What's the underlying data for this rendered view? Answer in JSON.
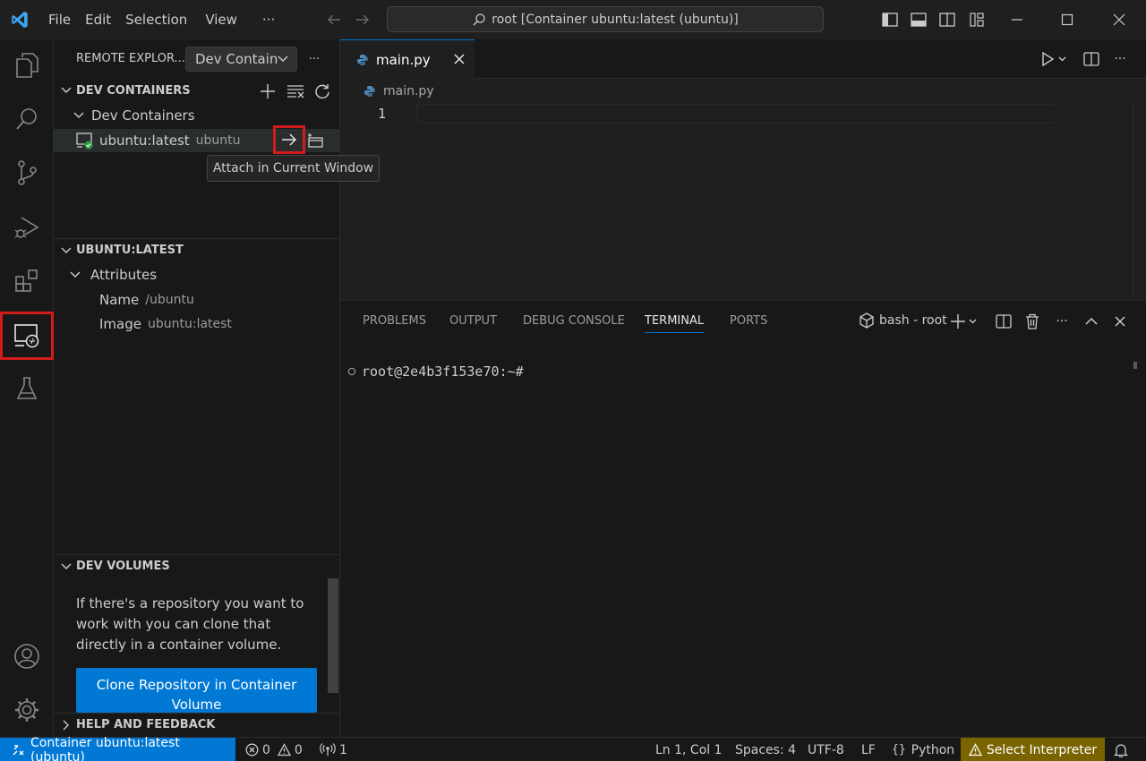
{
  "titlebar": {
    "menus": [
      "File",
      "Edit",
      "Selection",
      "View"
    ],
    "more": "···",
    "command_center": "root [Container ubuntu:latest (ubuntu)]"
  },
  "sidebar": {
    "title": "REMOTE EXPLOR...",
    "select_value": "Dev Contain",
    "more": "···",
    "dev_containers": {
      "header": "DEV CONTAINERS",
      "group_label": "Dev Containers",
      "item_label": "ubuntu:latest",
      "item_desc": "ubuntu",
      "tooltip": "Attach in Current Window"
    },
    "details": {
      "header": "UBUNTU:LATEST",
      "group_label": "Attributes",
      "attrs": [
        {
          "key": "Name",
          "value": "/ubuntu"
        },
        {
          "key": "Image",
          "value": "ubuntu:latest"
        }
      ]
    },
    "volumes": {
      "header": "DEV VOLUMES",
      "text": "If there's a repository you want to work with you can clone that directly in a container volume.",
      "button": "Clone Repository in Container Volume"
    },
    "help": {
      "header": "HELP AND FEEDBACK"
    }
  },
  "editor": {
    "tab_label": "main.py",
    "breadcrumb": "main.py",
    "line_number": "1",
    "more": "···"
  },
  "panel": {
    "tabs": [
      "PROBLEMS",
      "OUTPUT",
      "DEBUG CONSOLE",
      "TERMINAL",
      "PORTS"
    ],
    "active_tab": "TERMINAL",
    "terminal_name": "bash - root",
    "more": "···",
    "prompt": "root@2e4b3f153e70:~#"
  },
  "statusbar": {
    "remote": "Container ubuntu:latest (ubuntu)",
    "errors": "0",
    "warnings": "0",
    "ports": "1",
    "position": "Ln 1, Col 1",
    "spaces": "Spaces: 4",
    "encoding": "UTF-8",
    "eol": "LF",
    "language": "Python",
    "interpreter": "Select Interpreter"
  },
  "colors": {
    "accent": "#0078d4",
    "highlight_box": "#d21b1b",
    "warning_bg": "#7a6400",
    "python_icon": "#4b8bbe",
    "running_badge": "#2ea043"
  },
  "icons": {
    "activitybar": [
      "explorer-icon",
      "search-icon",
      "source-control-icon",
      "run-debug-icon",
      "extensions-icon",
      "remote-explorer-icon",
      "testing-icon",
      "accounts-icon",
      "settings-gear-icon"
    ]
  }
}
